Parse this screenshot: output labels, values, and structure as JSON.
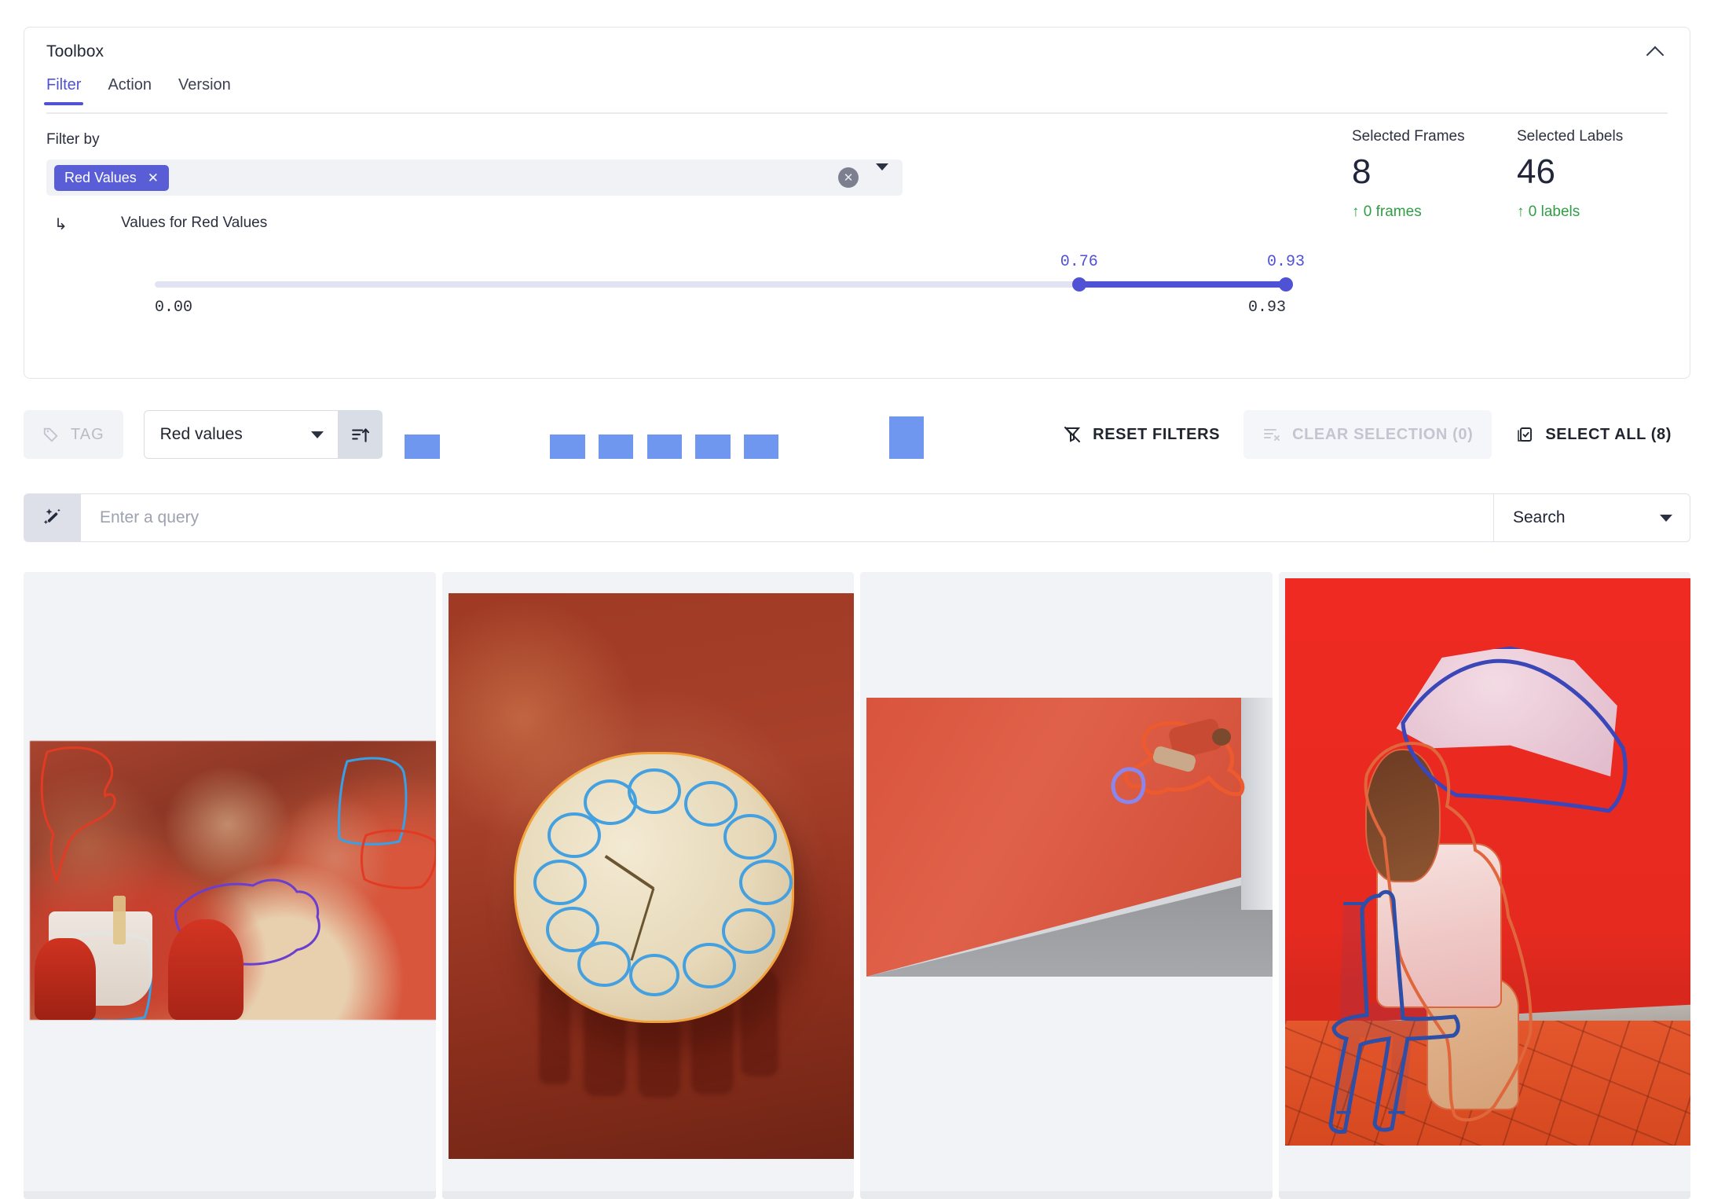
{
  "toolbox": {
    "title": "Toolbox",
    "collapse_icon": "chevron-up-icon",
    "tabs": [
      {
        "label": "Filter",
        "active": true
      },
      {
        "label": "Action",
        "active": false
      },
      {
        "label": "Version",
        "active": false
      }
    ],
    "filter": {
      "filter_by_label": "Filter by",
      "chip": {
        "label": "Red Values",
        "remove_icon": "close-icon"
      },
      "clear_icon": "clear-circle-icon",
      "dropdown_icon": "chevron-down-icon",
      "subfilter_arrow": "corner-down-right-icon",
      "subfilter_label": "Values for Red Values",
      "slider": {
        "min_label": "0.00",
        "max_label": "0.93",
        "low_value_label": "0.76",
        "high_value_label": "0.93",
        "min": 0.0,
        "max": 0.93,
        "low": 0.76,
        "high": 0.93,
        "accent": "#4f52d4"
      }
    },
    "stats": [
      {
        "label": "Selected Frames",
        "value": "8",
        "delta": "↑ 0 frames",
        "delta_color": "#2f9e44"
      },
      {
        "label": "Selected Labels",
        "value": "46",
        "delta": "↑ 0 labels",
        "delta_color": "#2f9e44"
      }
    ]
  },
  "action_bar": {
    "tag_button": {
      "label": "TAG",
      "icon": "tag-icon",
      "disabled": true
    },
    "metric_select": {
      "value": "Red values",
      "icon": "chevron-down-icon"
    },
    "sort_button": {
      "icon": "sort-ascending-icon"
    },
    "reset_filters": {
      "label": "RESET FILTERS",
      "icon": "filter-off-icon"
    },
    "clear_selection": {
      "label": "CLEAR SELECTION (0)",
      "icon": "list-x-icon",
      "disabled": true
    },
    "select_all": {
      "label": "SELECT ALL (8)",
      "icon": "checkbox-icon"
    },
    "histogram": {
      "type": "bar",
      "bar_color": "#6f97f0",
      "title": "",
      "xlabel": "",
      "ylabel": "",
      "categories": [
        "b1",
        "b2",
        "b3",
        "b4",
        "b5",
        "b6",
        "b7",
        "b8",
        "b9",
        "b10",
        "b11",
        "b12"
      ],
      "values": [
        1,
        0,
        0,
        1,
        1,
        1,
        1,
        1,
        0,
        0,
        2,
        0
      ],
      "ylim": [
        0,
        2
      ]
    }
  },
  "query_bar": {
    "wand_icon": "magic-wand-icon",
    "placeholder": "Enter a query",
    "value": "",
    "mode_select": {
      "value": "Search",
      "icon": "chevron-down-icon"
    }
  },
  "gallery": {
    "cards": [
      {
        "name": "frame-food-table",
        "alt": "Blurred restaurant table with drink cup, ketchup bottles and a sandwich with annotation outlines"
      },
      {
        "name": "frame-cup-clock",
        "alt": "Clock made of teacups on a plate over a red cloth with annotation outlines"
      },
      {
        "name": "frame-skate-ramp",
        "alt": "Skateboarder riding a red concrete wall ramp with annotation outlines"
      },
      {
        "name": "frame-umbrella-girl",
        "alt": "Woman with pink umbrella sitting on a chair in front of a red wall with annotation outlines"
      }
    ]
  }
}
